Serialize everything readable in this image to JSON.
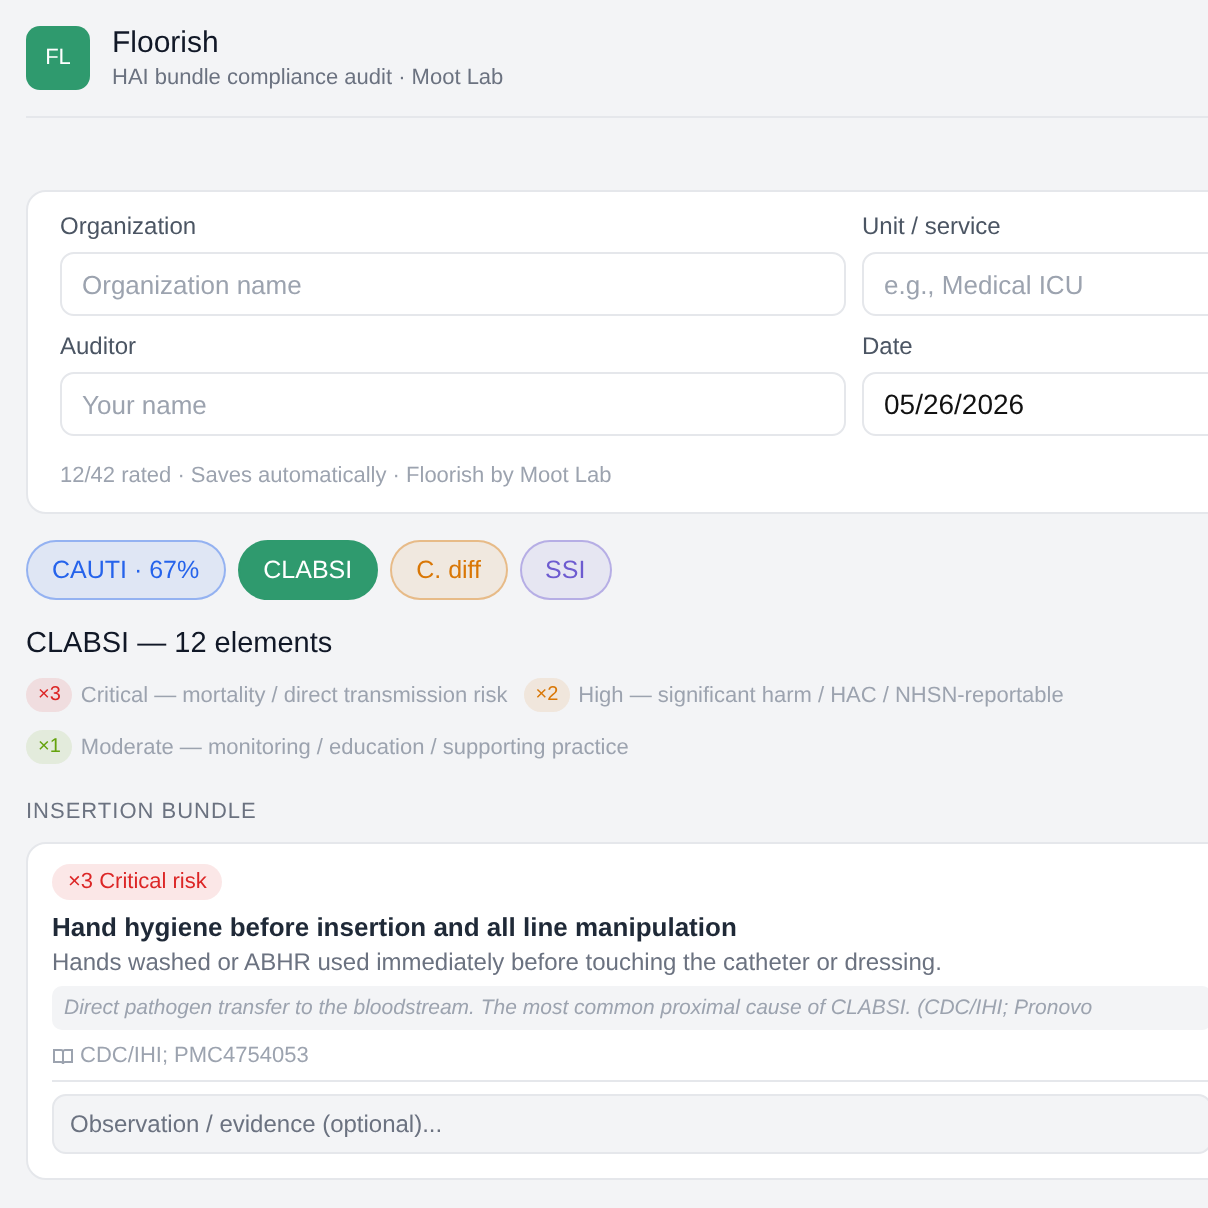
{
  "app": {
    "logo": "FL",
    "title": "Floorish",
    "subtitle": "HAI bundle compliance audit · Moot Lab"
  },
  "form": {
    "fields": [
      {
        "label": "Organization",
        "placeholder": "Organization name"
      },
      {
        "label": "Unit / service",
        "placeholder": "e.g., Medical ICU"
      },
      {
        "label": "Auditor",
        "placeholder": "Your name"
      },
      {
        "label": "Date",
        "value": "05/26/2026"
      }
    ],
    "footer": "12/42 rated · Saves automatically · Floorish by Moot Lab"
  },
  "tabs": [
    {
      "label": "CAUTI · 67%",
      "selected": false,
      "color": "#2563eb"
    },
    {
      "label": "CLABSI",
      "selected": true,
      "color": "#2f9a6e"
    },
    {
      "label": "C. diff",
      "selected": false,
      "color": "#d97706"
    },
    {
      "label": "SSI",
      "selected": false,
      "color": "#6d5bd0"
    }
  ],
  "heading": "CLABSI — 12 elements",
  "legend": [
    {
      "badge": "×3",
      "text": "Critical — mortality / direct transmission risk",
      "color": "#dc2626"
    },
    {
      "badge": "×2",
      "text": "High — significant harm / HAC / NHSN-reportable",
      "color": "#d97706"
    },
    {
      "badge": "×1",
      "text": "Moderate — monitoring / education / supporting practice",
      "color": "#65a30d"
    }
  ],
  "section": "INSERTION BUNDLE",
  "items": [
    {
      "risk": "×3 Critical risk",
      "color": "#dc2626",
      "title": "Hand hygiene before insertion and all line manipulation",
      "description": "Hands washed or ABHR used immediately before touching the catheter or dressing.",
      "rationale": "Direct pathogen transfer to the bloodstream. The most common proximal cause of CLABSI. (CDC/IHI; Pronovo",
      "source": "CDC/IHI; PMC4754053",
      "note_placeholder": "Observation / evidence (optional)..."
    }
  ]
}
